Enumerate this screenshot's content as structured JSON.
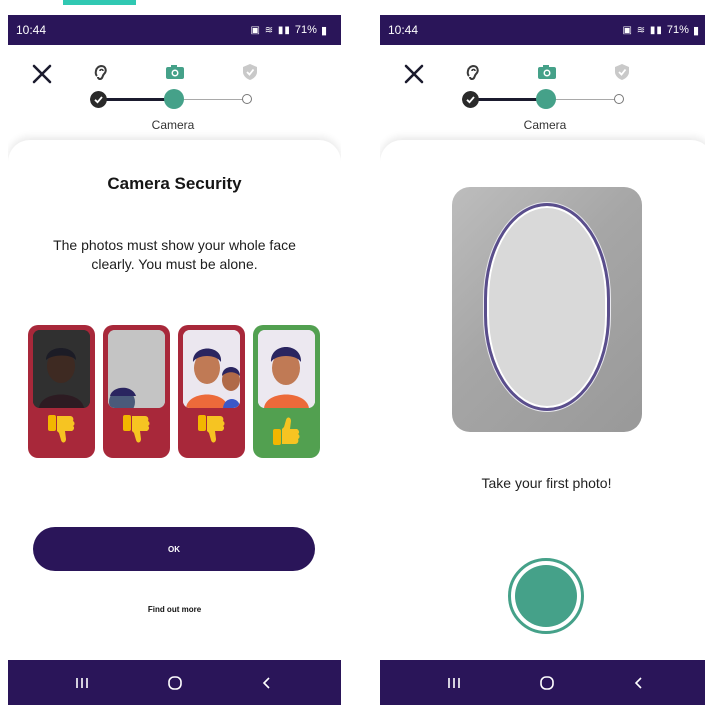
{
  "colors": {
    "brand_dark": "#2a1559",
    "accent_teal": "#45a189",
    "reject_red": "#a8283a",
    "accept_green": "#52a050"
  },
  "left_screen": {
    "status": {
      "time": "10:44",
      "battery": "71%"
    },
    "stepper": {
      "current_step_label": "Camera",
      "steps": [
        "ear-icon",
        "camera-icon",
        "shield-icon"
      ]
    },
    "card": {
      "title": "Camera Security",
      "description": "The photos must show your whole face clearly. You must be alone.",
      "examples": [
        {
          "kind": "too-dark",
          "verdict": "thumbs-down-icon"
        },
        {
          "kind": "face-not-visible",
          "verdict": "thumbs-down-icon"
        },
        {
          "kind": "not-alone",
          "verdict": "thumbs-down-icon"
        },
        {
          "kind": "correct",
          "verdict": "thumbs-up-icon"
        }
      ],
      "ok_label": "OK",
      "find_out_more_label": "Find out more"
    },
    "nav": [
      "recent-apps-icon",
      "home-icon",
      "back-icon"
    ]
  },
  "right_screen": {
    "status": {
      "time": "10:44",
      "battery": "71%"
    },
    "stepper": {
      "current_step_label": "Camera"
    },
    "instruction": "Take your first photo!",
    "nav": [
      "recent-apps-icon",
      "home-icon",
      "back-icon"
    ]
  }
}
